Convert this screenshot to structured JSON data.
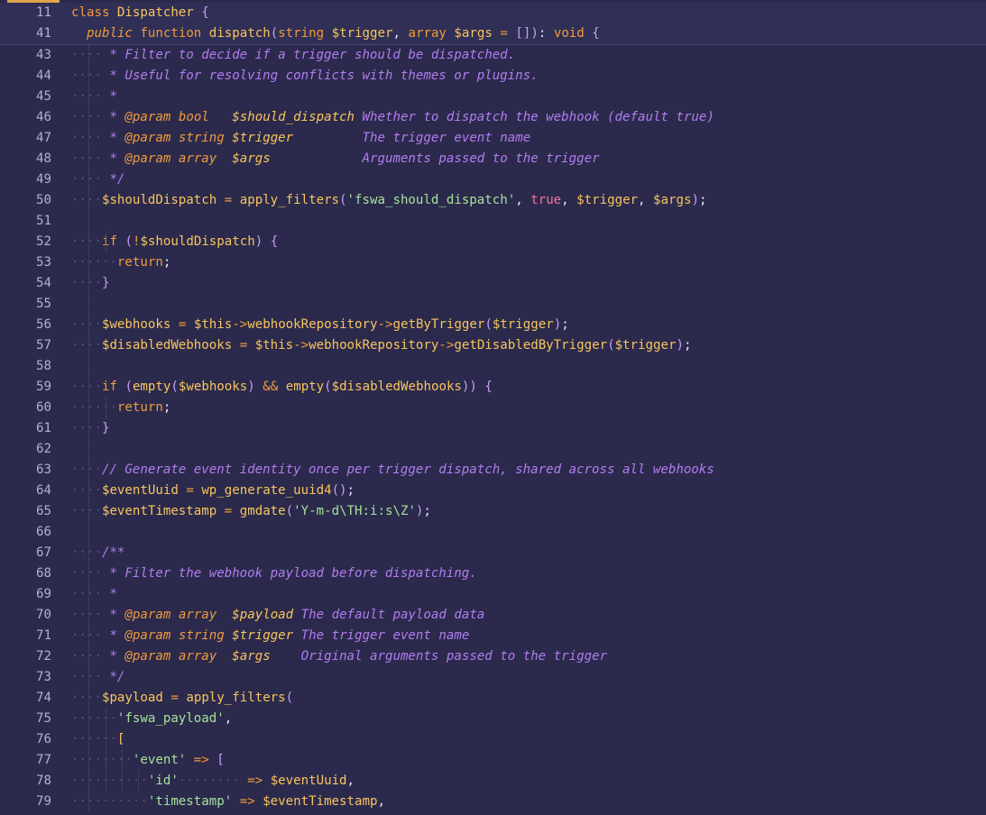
{
  "editor": {
    "sticky_lines": [
      {
        "num": "11",
        "tokens": [
          [
            "k",
            "class "
          ],
          [
            "fn",
            "Dispatcher"
          ],
          [
            "p",
            " "
          ],
          [
            "pu",
            "{"
          ]
        ]
      },
      {
        "num": "41",
        "tokens": [
          [
            "p",
            "  "
          ],
          [
            "kw",
            "public"
          ],
          [
            "p",
            " "
          ],
          [
            "k",
            "function"
          ],
          [
            "p",
            " "
          ],
          [
            "fn",
            "dispatch"
          ],
          [
            "pu",
            "("
          ],
          [
            "k",
            "string"
          ],
          [
            "p",
            " "
          ],
          [
            "v",
            "$trigger"
          ],
          [
            "p",
            ", "
          ],
          [
            "k",
            "array"
          ],
          [
            "p",
            " "
          ],
          [
            "v",
            "$args"
          ],
          [
            "p",
            " "
          ],
          [
            "k",
            "="
          ],
          [
            "p",
            " "
          ],
          [
            "pu",
            "[]"
          ],
          [
            "pu",
            ")"
          ],
          [
            "p",
            ": "
          ],
          [
            "k",
            "void"
          ],
          [
            "p",
            " "
          ],
          [
            "pu",
            "{"
          ]
        ]
      }
    ],
    "lines": [
      {
        "num": "43",
        "tokens": [
          [
            "ws",
            "····"
          ],
          [
            "c",
            " * Filter to decide if a trigger should be dispatched."
          ]
        ]
      },
      {
        "num": "44",
        "tokens": [
          [
            "ws",
            "····"
          ],
          [
            "c",
            " * Useful for resolving conflicts with themes or plugins."
          ]
        ]
      },
      {
        "num": "45",
        "tokens": [
          [
            "ws",
            "····"
          ],
          [
            "c",
            " *"
          ]
        ]
      },
      {
        "num": "46",
        "tokens": [
          [
            "ws",
            "····"
          ],
          [
            "c",
            " * "
          ],
          [
            "ca",
            "@param"
          ],
          [
            "c",
            " "
          ],
          [
            "ca",
            "bool"
          ],
          [
            "c",
            "   "
          ],
          [
            "ct",
            "$should_dispatch"
          ],
          [
            "c",
            " Whether to dispatch the webhook (default true)"
          ]
        ]
      },
      {
        "num": "47",
        "tokens": [
          [
            "ws",
            "····"
          ],
          [
            "c",
            " * "
          ],
          [
            "ca",
            "@param"
          ],
          [
            "c",
            " "
          ],
          [
            "ca",
            "string"
          ],
          [
            "c",
            " "
          ],
          [
            "ct",
            "$trigger"
          ],
          [
            "c",
            "         The trigger event name"
          ]
        ]
      },
      {
        "num": "48",
        "tokens": [
          [
            "ws",
            "····"
          ],
          [
            "c",
            " * "
          ],
          [
            "ca",
            "@param"
          ],
          [
            "c",
            " "
          ],
          [
            "ca",
            "array"
          ],
          [
            "c",
            "  "
          ],
          [
            "ct",
            "$args"
          ],
          [
            "c",
            "            Arguments passed to the trigger"
          ]
        ]
      },
      {
        "num": "49",
        "tokens": [
          [
            "ws",
            "····"
          ],
          [
            "c",
            " */"
          ]
        ]
      },
      {
        "num": "50",
        "tokens": [
          [
            "ws",
            "····"
          ],
          [
            "v",
            "$shouldDispatch"
          ],
          [
            "p",
            " "
          ],
          [
            "k",
            "="
          ],
          [
            "p",
            " "
          ],
          [
            "fn",
            "apply_filters"
          ],
          [
            "pu",
            "("
          ],
          [
            "s",
            "'fswa_should_dispatch'"
          ],
          [
            "p",
            ", "
          ],
          [
            "tr",
            "true"
          ],
          [
            "p",
            ", "
          ],
          [
            "v",
            "$trigger"
          ],
          [
            "p",
            ", "
          ],
          [
            "v",
            "$args"
          ],
          [
            "pu",
            ")"
          ],
          [
            "p",
            ";"
          ]
        ]
      },
      {
        "num": "51",
        "tokens": []
      },
      {
        "num": "52",
        "tokens": [
          [
            "ws",
            "····"
          ],
          [
            "k",
            "if"
          ],
          [
            "p",
            " "
          ],
          [
            "pu",
            "("
          ],
          [
            "k",
            "!"
          ],
          [
            "v",
            "$shouldDispatch"
          ],
          [
            "pu",
            ")"
          ],
          [
            "p",
            " "
          ],
          [
            "pu",
            "{"
          ]
        ]
      },
      {
        "num": "53",
        "tokens": [
          [
            "ws",
            "······"
          ],
          [
            "k",
            "return"
          ],
          [
            "p",
            ";"
          ]
        ]
      },
      {
        "num": "54",
        "tokens": [
          [
            "ws",
            "····"
          ],
          [
            "pu",
            "}"
          ]
        ]
      },
      {
        "num": "55",
        "tokens": []
      },
      {
        "num": "56",
        "tokens": [
          [
            "ws",
            "····"
          ],
          [
            "v",
            "$webhooks"
          ],
          [
            "p",
            " "
          ],
          [
            "k",
            "="
          ],
          [
            "p",
            " "
          ],
          [
            "v",
            "$this"
          ],
          [
            "k",
            "->"
          ],
          [
            "fn",
            "webhookRepository"
          ],
          [
            "k",
            "->"
          ],
          [
            "fn",
            "getByTrigger"
          ],
          [
            "pu",
            "("
          ],
          [
            "v",
            "$trigger"
          ],
          [
            "pu",
            ")"
          ],
          [
            "p",
            ";"
          ]
        ]
      },
      {
        "num": "57",
        "tokens": [
          [
            "ws",
            "····"
          ],
          [
            "v",
            "$disabledWebhooks"
          ],
          [
            "p",
            " "
          ],
          [
            "k",
            "="
          ],
          [
            "p",
            " "
          ],
          [
            "v",
            "$this"
          ],
          [
            "k",
            "->"
          ],
          [
            "fn",
            "webhookRepository"
          ],
          [
            "k",
            "->"
          ],
          [
            "fn",
            "getDisabledByTrigger"
          ],
          [
            "pu",
            "("
          ],
          [
            "v",
            "$trigger"
          ],
          [
            "pu",
            ")"
          ],
          [
            "p",
            ";"
          ]
        ]
      },
      {
        "num": "58",
        "tokens": []
      },
      {
        "num": "59",
        "tokens": [
          [
            "ws",
            "····"
          ],
          [
            "k",
            "if"
          ],
          [
            "p",
            " "
          ],
          [
            "pu",
            "("
          ],
          [
            "fn",
            "empty"
          ],
          [
            "pu",
            "("
          ],
          [
            "v",
            "$webhooks"
          ],
          [
            "pu",
            ")"
          ],
          [
            "p",
            " "
          ],
          [
            "k",
            "&&"
          ],
          [
            "p",
            " "
          ],
          [
            "fn",
            "empty"
          ],
          [
            "pu",
            "("
          ],
          [
            "v",
            "$disabledWebhooks"
          ],
          [
            "pu",
            "))"
          ],
          [
            "p",
            " "
          ],
          [
            "pu",
            "{"
          ]
        ]
      },
      {
        "num": "60",
        "tokens": [
          [
            "ws",
            "······"
          ],
          [
            "k",
            "return"
          ],
          [
            "p",
            ";"
          ]
        ]
      },
      {
        "num": "61",
        "tokens": [
          [
            "ws",
            "····"
          ],
          [
            "pu",
            "}"
          ]
        ]
      },
      {
        "num": "62",
        "tokens": []
      },
      {
        "num": "63",
        "tokens": [
          [
            "ws",
            "····"
          ],
          [
            "c",
            "// Generate event identity once per trigger dispatch, shared across all webhooks"
          ]
        ]
      },
      {
        "num": "64",
        "tokens": [
          [
            "ws",
            "····"
          ],
          [
            "v",
            "$eventUuid"
          ],
          [
            "p",
            " "
          ],
          [
            "k",
            "="
          ],
          [
            "p",
            " "
          ],
          [
            "fn",
            "wp_generate_uuid4"
          ],
          [
            "pu",
            "()"
          ],
          [
            "p",
            ";"
          ]
        ]
      },
      {
        "num": "65",
        "tokens": [
          [
            "ws",
            "····"
          ],
          [
            "v",
            "$eventTimestamp"
          ],
          [
            "p",
            " "
          ],
          [
            "k",
            "="
          ],
          [
            "p",
            " "
          ],
          [
            "fn",
            "gmdate"
          ],
          [
            "pu",
            "("
          ],
          [
            "s",
            "'Y-m-d\\TH:i:s\\Z'"
          ],
          [
            "pu",
            ")"
          ],
          [
            "p",
            ";"
          ]
        ]
      },
      {
        "num": "66",
        "tokens": []
      },
      {
        "num": "67",
        "tokens": [
          [
            "ws",
            "····"
          ],
          [
            "c",
            "/**"
          ]
        ]
      },
      {
        "num": "68",
        "tokens": [
          [
            "ws",
            "····"
          ],
          [
            "c",
            " * Filter the webhook payload before dispatching."
          ]
        ]
      },
      {
        "num": "69",
        "tokens": [
          [
            "ws",
            "····"
          ],
          [
            "c",
            " *"
          ]
        ]
      },
      {
        "num": "70",
        "tokens": [
          [
            "ws",
            "····"
          ],
          [
            "c",
            " * "
          ],
          [
            "ca",
            "@param"
          ],
          [
            "c",
            " "
          ],
          [
            "ca",
            "array"
          ],
          [
            "c",
            "  "
          ],
          [
            "ct",
            "$payload"
          ],
          [
            "c",
            " The default payload data"
          ]
        ]
      },
      {
        "num": "71",
        "tokens": [
          [
            "ws",
            "····"
          ],
          [
            "c",
            " * "
          ],
          [
            "ca",
            "@param"
          ],
          [
            "c",
            " "
          ],
          [
            "ca",
            "string"
          ],
          [
            "c",
            " "
          ],
          [
            "ct",
            "$trigger"
          ],
          [
            "c",
            " The trigger event name"
          ]
        ]
      },
      {
        "num": "72",
        "tokens": [
          [
            "ws",
            "····"
          ],
          [
            "c",
            " * "
          ],
          [
            "ca",
            "@param"
          ],
          [
            "c",
            " "
          ],
          [
            "ca",
            "array"
          ],
          [
            "c",
            "  "
          ],
          [
            "ct",
            "$args"
          ],
          [
            "c",
            "    Original arguments passed to the trigger"
          ]
        ]
      },
      {
        "num": "73",
        "tokens": [
          [
            "ws",
            "····"
          ],
          [
            "c",
            " */"
          ]
        ]
      },
      {
        "num": "74",
        "tokens": [
          [
            "ws",
            "····"
          ],
          [
            "v",
            "$payload"
          ],
          [
            "p",
            " "
          ],
          [
            "k",
            "="
          ],
          [
            "p",
            " "
          ],
          [
            "fn",
            "apply_filters"
          ],
          [
            "pu",
            "("
          ]
        ]
      },
      {
        "num": "75",
        "tokens": [
          [
            "ws",
            "······"
          ],
          [
            "s",
            "'fswa_payload'"
          ],
          [
            "p",
            ","
          ]
        ]
      },
      {
        "num": "76",
        "tokens": [
          [
            "ws",
            "······"
          ],
          [
            "ar",
            "["
          ]
        ]
      },
      {
        "num": "77",
        "tokens": [
          [
            "ws",
            "········"
          ],
          [
            "s",
            "'event'"
          ],
          [
            "p",
            " "
          ],
          [
            "k",
            "=>"
          ],
          [
            "p",
            " "
          ],
          [
            "pu",
            "["
          ]
        ]
      },
      {
        "num": "78",
        "tokens": [
          [
            "ws",
            "··········"
          ],
          [
            "s",
            "'id'"
          ],
          [
            "ws",
            "········"
          ],
          [
            "p",
            " "
          ],
          [
            "k",
            "=>"
          ],
          [
            "p",
            " "
          ],
          [
            "v",
            "$eventUuid"
          ],
          [
            "p",
            ","
          ]
        ]
      },
      {
        "num": "79",
        "tokens": [
          [
            "ws",
            "··········"
          ],
          [
            "s",
            "'timestamp'"
          ],
          [
            "p",
            " "
          ],
          [
            "k",
            "=>"
          ],
          [
            "p",
            " "
          ],
          [
            "v",
            "$eventTimestamp"
          ],
          [
            "p",
            ","
          ]
        ]
      }
    ]
  },
  "colors": {
    "background": "#2b2a4c",
    "sticky_background": "#302f55",
    "line_number": "#b3b1d2",
    "keyword": "#f19a3e",
    "function": "#f8c45e",
    "string": "#a7e19a",
    "comment": "#b27cf0",
    "boolean": "#ff6e9a",
    "active_tab_indicator": "#e0a44a"
  }
}
